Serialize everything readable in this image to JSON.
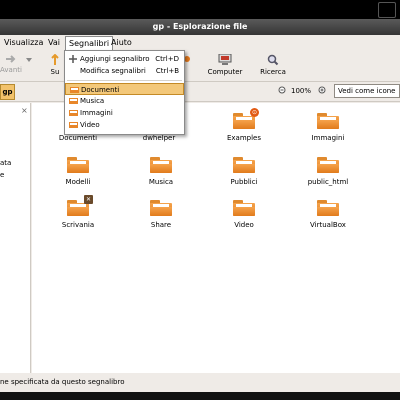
{
  "window": {
    "title": "gp - Esplorazione file"
  },
  "menubar": {
    "items": [
      {
        "label": "Visualizza"
      },
      {
        "label": "Vai"
      },
      {
        "label": "Segnalibri"
      },
      {
        "label": "Aiuto"
      }
    ]
  },
  "toolbar": {
    "back_label": "Avanti",
    "up_label": "Su",
    "computer_label": "Computer",
    "search_label": "Ricerca"
  },
  "location": {
    "crumb_label": "gp",
    "zoom_value": "100%",
    "view_mode": "Vedi come icone"
  },
  "sidebar": {
    "lines": [
      "ata",
      "e"
    ]
  },
  "bookmarks_menu": {
    "items": [
      {
        "label": "Aggiungi segnalibro",
        "accel": "Ctrl+D"
      },
      {
        "label": "Modifica segnalibri",
        "accel": "Ctrl+B"
      },
      {
        "label": "Documenti"
      },
      {
        "label": "Musica"
      },
      {
        "label": "Immagini"
      },
      {
        "label": "Video"
      }
    ]
  },
  "files": [
    {
      "name": "Documenti"
    },
    {
      "name": "dwhelper"
    },
    {
      "name": "Examples",
      "emblem": "lock-icon"
    },
    {
      "name": "Immagini"
    },
    {
      "name": "Modelli"
    },
    {
      "name": "Musica"
    },
    {
      "name": "Pubblici"
    },
    {
      "name": "public_html"
    },
    {
      "name": "Scrivania",
      "emblem": "desktop-icon"
    },
    {
      "name": "Share"
    },
    {
      "name": "Video"
    },
    {
      "name": "VirtualBox"
    }
  ],
  "statusbar": {
    "text": "ne specificata da questo segnalibro"
  },
  "colors": {
    "folder": "#e8872a",
    "menu_highlight": "#f3c87a",
    "titlebar": "#3d3d3d"
  }
}
